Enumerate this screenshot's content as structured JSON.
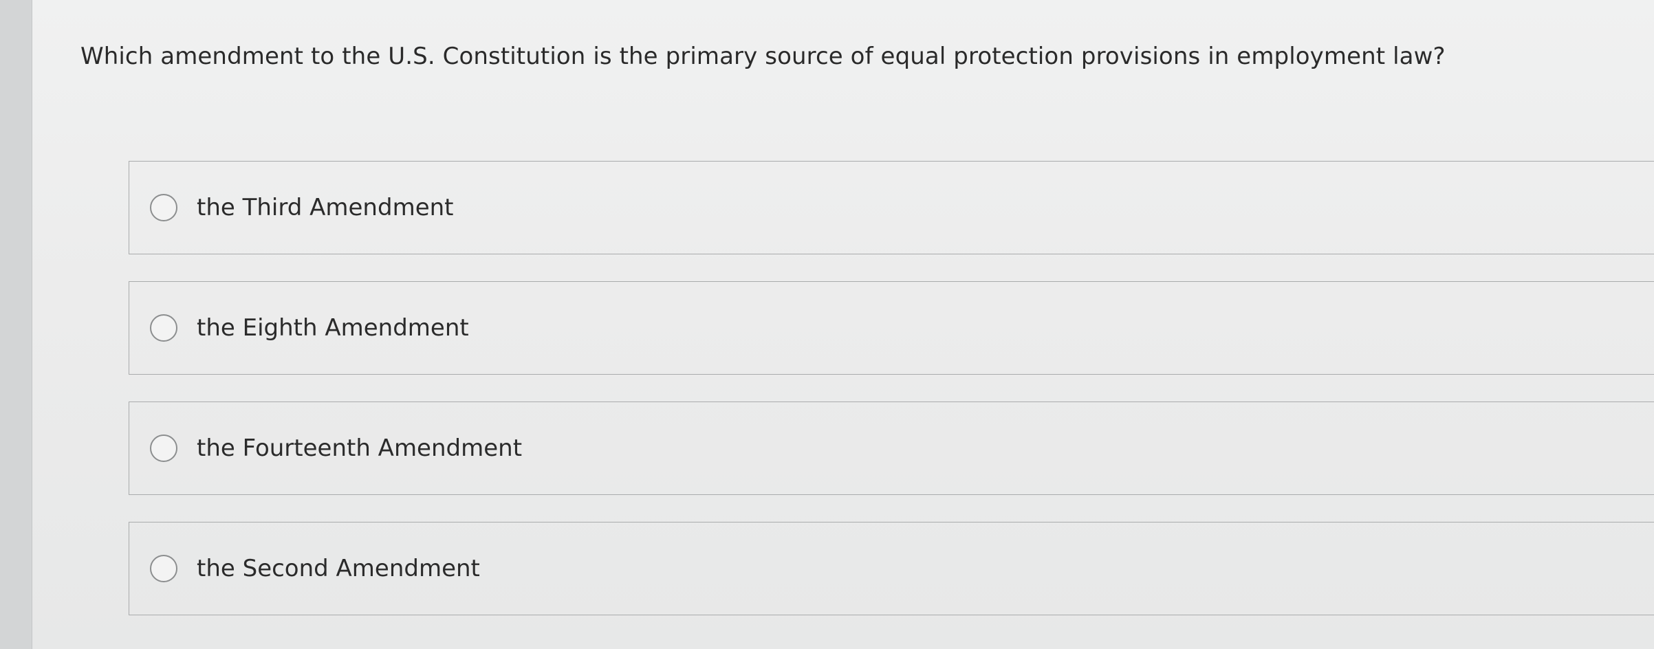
{
  "question": {
    "text": "Which amendment to the U.S. Constitution is the primary source of equal protection provisions in employment law?"
  },
  "options": [
    {
      "label": "the Third Amendment",
      "selected": false
    },
    {
      "label": "the Eighth Amendment",
      "selected": false
    },
    {
      "label": "the Fourteenth Amendment",
      "selected": false
    },
    {
      "label": "the Second Amendment",
      "selected": false
    }
  ]
}
